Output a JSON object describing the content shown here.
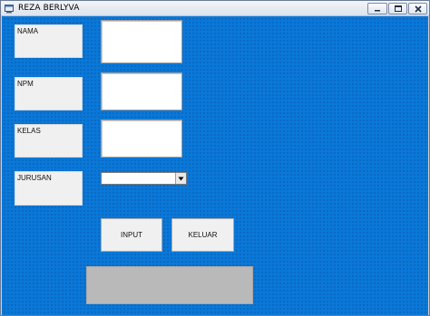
{
  "window": {
    "title": "REZA BERLYVA",
    "controls": {
      "minimize": "minimize-icon",
      "maximize": "maximize-icon",
      "close": "close-icon"
    }
  },
  "form": {
    "labels": {
      "nama": "NAMA",
      "npm": "NPM",
      "kelas": "KELAS",
      "jurusan": "JURUSAN"
    },
    "inputs": {
      "nama_value": "",
      "npm_value": "",
      "kelas_value": ""
    },
    "jurusan_select": {
      "selected": ""
    },
    "buttons": {
      "input_label": "INPUT",
      "keluar_label": "KELUAR"
    },
    "output_text": ""
  },
  "colors": {
    "client_background": "#0a78d8",
    "output_panel": "#b9b9b9",
    "label_background": "#f0f0f0"
  }
}
